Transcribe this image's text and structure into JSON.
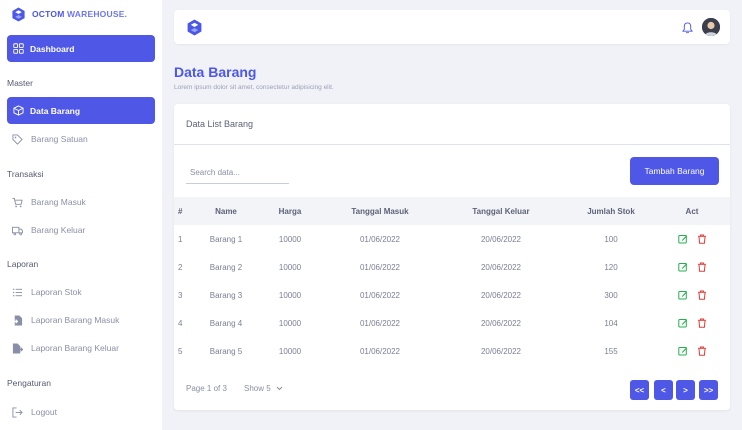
{
  "brand": {
    "name_part1": "OCTOM",
    "name_part2": "WAREHOUSE."
  },
  "sidebar": {
    "dashboard": "Dashboard",
    "sections": {
      "master": "Master",
      "transaksi": "Transaksi",
      "laporan": "Laporan",
      "pengaturan": "Pengaturan"
    },
    "items": {
      "data_barang": "Data Barang",
      "barang_satuan": "Barang Satuan",
      "barang_masuk": "Barang Masuk",
      "barang_keluar": "Barang Keluar",
      "laporan_stok": "Laporan Stok",
      "laporan_barang_masuk": "Laporan Barang Masuk",
      "laporan_barang_keluar": "Laporan Barang Keluar",
      "logout": "Logout"
    }
  },
  "page": {
    "title": "Data Barang",
    "subtitle": "Lorem ipsum dolor sit amet, consectetur adipisicing elit."
  },
  "card": {
    "header": "Data List Barang",
    "search_placeholder": "Search data...",
    "add_button": "Tambah Barang"
  },
  "table": {
    "columns": [
      "#",
      "Name",
      "Harga",
      "Tanggal Masuk",
      "Tanggal Keluar",
      "Jumlah Stok",
      "Act"
    ],
    "rows": [
      [
        "1",
        "Barang 1",
        "10000",
        "01/06/2022",
        "20/06/2022",
        "100"
      ],
      [
        "2",
        "Barang 2",
        "10000",
        "01/06/2022",
        "20/06/2022",
        "120"
      ],
      [
        "3",
        "Barang 3",
        "10000",
        "01/06/2022",
        "20/06/2022",
        "300"
      ],
      [
        "4",
        "Barang 4",
        "10000",
        "01/06/2022",
        "20/06/2022",
        "104"
      ],
      [
        "5",
        "Barang 5",
        "10000",
        "01/06/2022",
        "20/06/2022",
        "155"
      ]
    ]
  },
  "pagination": {
    "info": "Page 1 of 3",
    "show": "Show 5",
    "first": "<<",
    "prev": "<",
    "next": ">",
    "last": ">>"
  },
  "colors": {
    "accent": "#4f57e6",
    "brand": "#4b57e8",
    "edit": "#22b14c",
    "delete": "#e53935"
  },
  "icons": {
    "logo": "cube-logo-icon",
    "dashboard": "grid-icon",
    "data_barang": "box-icon",
    "barang_satuan": "tag-icon",
    "barang_masuk": "cart-icon",
    "barang_keluar": "truck-icon",
    "laporan_stok": "list-icon",
    "laporan_barang_masuk": "file-import-icon",
    "laporan_barang_keluar": "file-export-icon",
    "logout": "logout-icon",
    "notifications": "bell-icon",
    "edit": "edit-icon",
    "delete": "trash-icon"
  }
}
